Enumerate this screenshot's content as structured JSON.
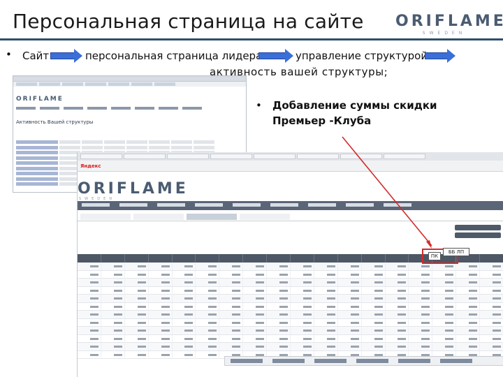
{
  "slide": {
    "title": "Персональная страница на сайте",
    "logo": {
      "main": "ORIFLAME",
      "sub": "SWEDEN"
    }
  },
  "breadcrumb": {
    "bullet": "•",
    "step1": "Сайт",
    "step2": "персональная страница лидера",
    "step3": "управление структурой",
    "step4": "активность вашей структуры;"
  },
  "side_point": {
    "bullet": "•",
    "text": "Добавление суммы скидки Премьер -Клуба"
  },
  "screenshot_small": {
    "logo": "ORIFLAME",
    "heading": "Активность Вашей структуры"
  },
  "screenshot_large": {
    "bookmark_yandex": "Яндекс",
    "logo": "ORIFLAME",
    "logo_sub": "SWEDEN",
    "badge_pk": "ПК",
    "badge_bbpp": "ББ ЛП"
  },
  "colors": {
    "title_rule": "#2d4f6c",
    "arrow": "#3a6fd8",
    "highlight": "#d42b2b"
  }
}
